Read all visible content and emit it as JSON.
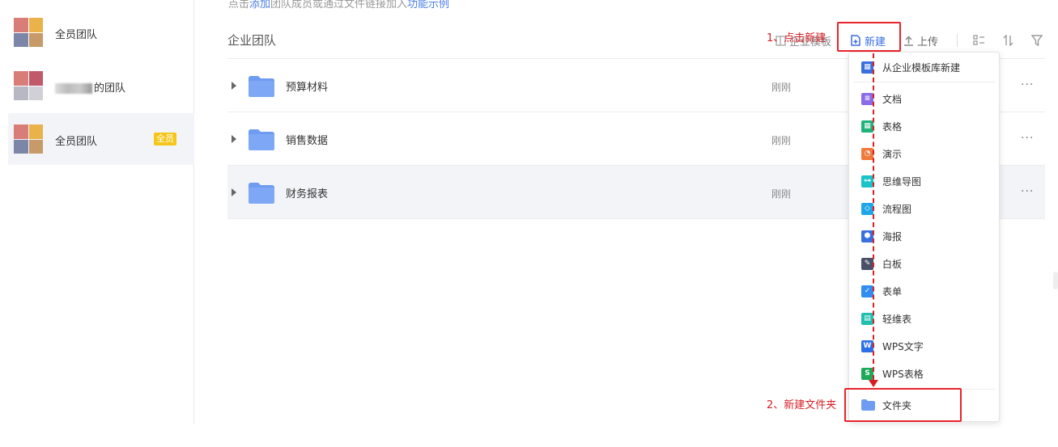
{
  "sidebar": {
    "teams": [
      {
        "name": "全员团队",
        "badge": ""
      },
      {
        "name": "的团队",
        "badge": ""
      },
      {
        "name": "全员团队",
        "badge": "全员"
      }
    ]
  },
  "main": {
    "hint": {
      "prefix": "点击",
      "link": "添加",
      "middle": "团队成员或通过文件链接加入",
      "link2": "功能示例"
    },
    "breadcrumb": "企业团队",
    "toolbar": {
      "template_label": "企业模板",
      "new_label": "新建",
      "upload_label": "上传"
    },
    "rows": [
      {
        "name": "预算材料",
        "time": "刚刚"
      },
      {
        "name": "销售数据",
        "time": "刚刚"
      },
      {
        "name": "财务报表",
        "time": "刚刚"
      }
    ]
  },
  "menu": {
    "from_template": "从企业模板库新建",
    "items": [
      {
        "label": "文档",
        "icon": "doc-icon",
        "color": "#8c6be8"
      },
      {
        "label": "表格",
        "icon": "sheet-icon",
        "color": "#1fb37a"
      },
      {
        "label": "演示",
        "icon": "slides-icon",
        "color": "#f07a3c"
      },
      {
        "label": "思维导图",
        "icon": "mindmap-icon",
        "color": "#19c3c8"
      },
      {
        "label": "流程图",
        "icon": "flowchart-icon",
        "color": "#1ea7e8"
      },
      {
        "label": "海报",
        "icon": "poster-icon",
        "color": "#3a6fe0"
      },
      {
        "label": "白板",
        "icon": "whiteboard-icon",
        "color": "#4a5068"
      },
      {
        "label": "表单",
        "icon": "form-icon",
        "color": "#2f8ef0"
      },
      {
        "label": "轻维表",
        "icon": "light-table-icon",
        "color": "#20bfb0"
      },
      {
        "label": "WPS文字",
        "icon": "wps-writer-icon",
        "color": "#2e6fe8"
      },
      {
        "label": "WPS表格",
        "icon": "wps-sheet-icon",
        "color": "#1ea85a"
      }
    ],
    "folder": "文件夹"
  },
  "annotations": {
    "step1": "1、点击新建",
    "step2": "2、新建文件夹"
  },
  "colors": {
    "accent": "#3a6fe0",
    "annotation": "#d71e24",
    "folder": "#6e9cf2",
    "badge": "#f5c518"
  }
}
